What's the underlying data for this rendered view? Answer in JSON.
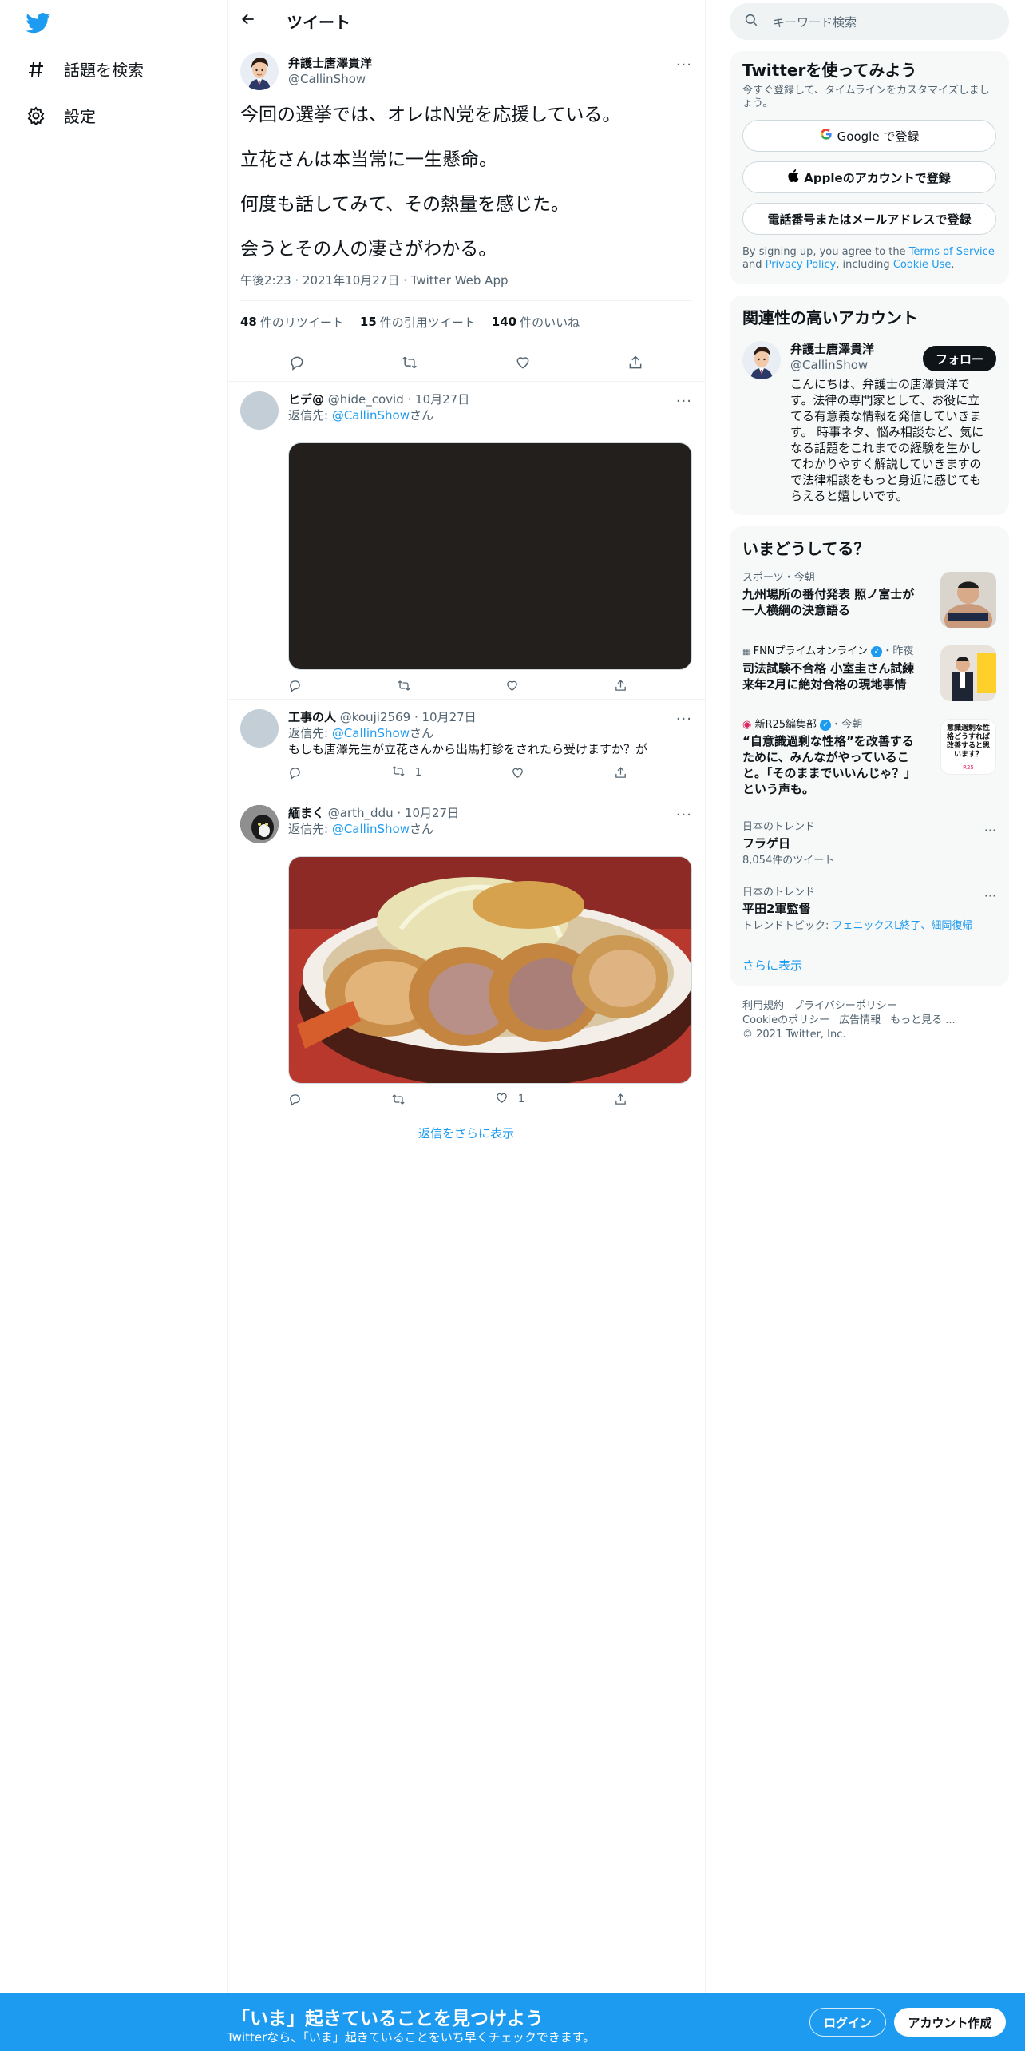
{
  "nav": {
    "explore": "話題を検索",
    "settings": "設定"
  },
  "header": {
    "title": "ツイート"
  },
  "tweet": {
    "name": "弁護士唐澤貴洋",
    "handle": "@CallinShow",
    "lines": [
      "今回の選挙では、オレはN党を応援している。",
      "立花さんは本当常に一生懸命。",
      "何度も話してみて、その熱量を感じた。",
      "会うとその人の凄さがわかる。"
    ],
    "time": "午後2:23",
    "date": "2021年10月27日",
    "source": "Twitter Web App",
    "retweets": "48",
    "retweets_label": "件のリツイート",
    "quotes": "15",
    "quotes_label": "件の引用ツイート",
    "likes": "140",
    "likes_label": "件のいいね"
  },
  "replies": [
    {
      "name": "ヒデ@",
      "handle": "@hide_covid",
      "date": "10月27日",
      "replyto_prefix": "返信先: ",
      "replyto_handle": "@CallinShow",
      "replyto_suffix": "さん",
      "text": "",
      "retweets": "",
      "likes": ""
    },
    {
      "name": "工事の人",
      "handle": "@kouji2569",
      "date": "10月27日",
      "replyto_prefix": "返信先: ",
      "replyto_handle": "@CallinShow",
      "replyto_suffix": "さん",
      "text": "もしも唐澤先生が立花さんから出馬打診をされたら受けますか？が",
      "retweets": "1",
      "likes": ""
    },
    {
      "name": "緬まく",
      "handle": "@arth_ddu",
      "date": "10月27日",
      "replyto_prefix": "返信先: ",
      "replyto_handle": "@CallinShow",
      "replyto_suffix": "さん",
      "text": "",
      "retweets": "",
      "likes": "1"
    }
  ],
  "show_more_replies": "返信をさらに表示",
  "search": {
    "placeholder": "キーワード検索"
  },
  "signup_card": {
    "title": "Twitterを使ってみよう",
    "subtitle": "今すぐ登録して、タイムラインをカスタマイズしましょう。",
    "google": "Google で登録",
    "apple": "Appleのアカウントで登録",
    "phone": "電話番号またはメールアドレスで登録",
    "legal_1": "By signing up, you agree to the ",
    "terms": "Terms of Service",
    "legal_2": " and ",
    "privacy": "Privacy Policy",
    "legal_3": ", including ",
    "cookie": "Cookie Use",
    "legal_4": "."
  },
  "related": {
    "title": "関連性の高いアカウント",
    "name": "弁護士唐澤貴洋",
    "handle": "@CallinShow",
    "follow": "フォロー",
    "bio": "こんにちは、弁護士の唐澤貴洋です。法律の専門家として、お役に立てる有意義な情報を発信していきます。 時事ネタ、悩み相談など、気になる話題をこれまでの経験を生かしてわかりやすく解説していきますので法律相談をもっと身近に感じてもらえると嬉しいです。"
  },
  "trends": {
    "title": "いまどうしてる？",
    "items": [
      {
        "cat": "スポーツ・今朝",
        "text": "九州場所の番付発表 照ノ富士が一人横綱の決意語る"
      },
      {
        "cat_source": "FNNプライムオンライン",
        "cat_time": "・昨夜",
        "text": "司法試験不合格 小室圭さん試練 来年2月に絶対合格の現地事情"
      },
      {
        "cat_source": "新R25編集部",
        "cat_time": "・今朝",
        "text": "“自意識過剰な性格”を改善するために、みんながやっていること。「そのままでいいんじゃ？」という声も。"
      },
      {
        "cat": "日本のトレンド",
        "text": "フラゲ日",
        "count": "8,054件のツイート"
      },
      {
        "cat": "日本のトレンド",
        "text": "平田2軍監督",
        "topic_prefix": "トレンドトピック: ",
        "topic": "フェニックスL終了、細岡復帰"
      }
    ],
    "show_more": "さらに表示",
    "thumb3_text": "意識過剰な性格どうすれば改善すると思います？",
    "thumb3_brand": "R25"
  },
  "footer": {
    "terms": "利用規約",
    "privacy": "プライバシーポリシー",
    "cookie": "Cookieのポリシー",
    "ads": "広告情報",
    "more": "もっと見る ...",
    "copyright": "© 2021 Twitter, Inc."
  },
  "banner": {
    "title": "「いま」起きていることを見つけよう",
    "subtitle": "Twitterなら、「いま」起きていることをいち早くチェックできます。",
    "login": "ログイン",
    "signup": "アカウント作成"
  },
  "colors": {
    "accent": "#1d9bf0",
    "text": "#0f1419",
    "muted": "#536471"
  }
}
